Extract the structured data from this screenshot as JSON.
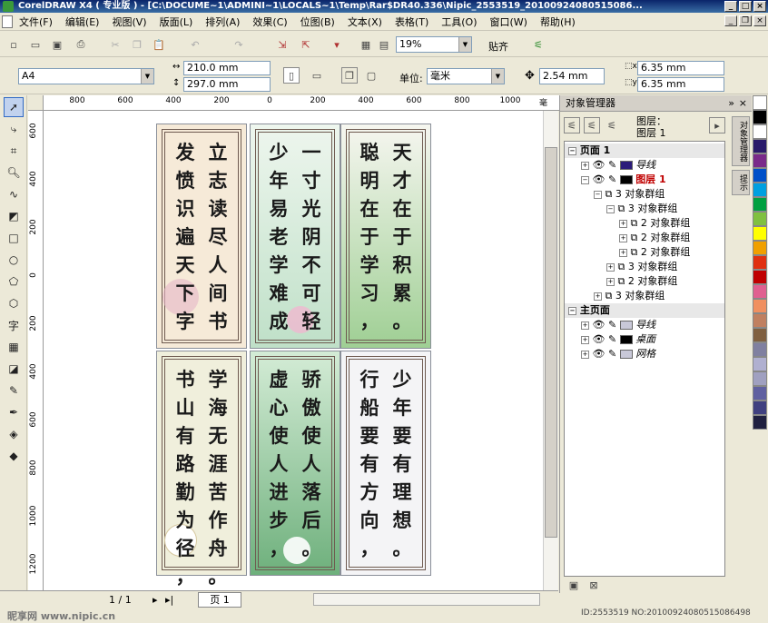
{
  "window": {
    "title": "CorelDRAW X4 ( 专业版 ) - [C:\\DOCUME~1\\ADMINI~1\\LOCALS~1\\Temp\\Rar$DR40.336\\Nipic_2553519_20100924080515086..."
  },
  "menu": [
    "文件(F)",
    "编辑(E)",
    "视图(V)",
    "版面(L)",
    "排列(A)",
    "效果(C)",
    "位图(B)",
    "文本(X)",
    "表格(T)",
    "工具(O)",
    "窗口(W)",
    "帮助(H)"
  ],
  "toolbar": {
    "zoom_value": "19%",
    "snap_label": "贴齐"
  },
  "propbar": {
    "paper_size": "A4",
    "width_value": "210.0 mm",
    "height_value": "297.0 mm",
    "unit_label": "单位:",
    "unit_value": "毫米",
    "nudge_value": "2.54 mm",
    "dup_x_value": "6.35 mm",
    "dup_y_value": "6.35 mm"
  },
  "ruler_h": [
    {
      "label": "800"
    },
    {
      "label": "600"
    },
    {
      "label": "400"
    },
    {
      "label": "200"
    },
    {
      "label": "0"
    },
    {
      "label": "200"
    },
    {
      "label": "400"
    },
    {
      "label": "600"
    },
    {
      "label": "800"
    },
    {
      "label": "1000"
    },
    {
      "label": "毫米"
    }
  ],
  "ruler_v": [
    {
      "label": "600"
    },
    {
      "label": "400"
    },
    {
      "label": "200"
    },
    {
      "label": "0"
    },
    {
      "label": "200"
    },
    {
      "label": "400"
    },
    {
      "label": "600"
    },
    {
      "label": "800"
    },
    {
      "label": "1000"
    },
    {
      "label": "1200"
    }
  ],
  "bookmarks": [
    {
      "columns": [
        "立志读尽人间书。",
        "发愤识遍天下字，"
      ],
      "colors": {
        "bg": "#f6ead8",
        "accent": "#e6b6c8"
      }
    },
    {
      "columns": [
        "一寸光阴不可轻。",
        "少年易老学难成，"
      ],
      "colors": {
        "bg": "#dff0e6",
        "accent": "#7cbf8c"
      }
    },
    {
      "columns": [
        "天才在于积累。",
        "聪明在于学习，"
      ],
      "colors": {
        "bg": "#eef3e6",
        "accent": "#90c48a"
      }
    },
    {
      "columns": [
        "学海无涯苦作舟。",
        "书山有路勤为径，"
      ],
      "colors": {
        "bg": "#f0efdc",
        "accent": "#c9d4a2"
      }
    },
    {
      "columns": [
        "骄傲使人落后。",
        "虚心使人进步，"
      ],
      "colors": {
        "bg": "#c6e2c8",
        "accent": "#4a9a5c"
      }
    },
    {
      "columns": [
        "少年要有理想。",
        "行船要有方向，"
      ],
      "colors": {
        "bg": "#f4f4f6",
        "accent": "#3a2a6e"
      }
    }
  ],
  "statusbar": {
    "page_counter": "1 / 1",
    "page_tab": "页 1"
  },
  "docker": {
    "title": "对象管理器",
    "layer_header": "图层：",
    "layer_value": "图层 1",
    "tree": [
      {
        "label": "页面 1",
        "indent": 0,
        "bold": true
      },
      {
        "label": "导线",
        "indent": 1,
        "color": "#2b1b7a"
      },
      {
        "label": "图层 1",
        "indent": 1,
        "color": "#000000",
        "red": true
      },
      {
        "label": "3 对象群组",
        "indent": 2
      },
      {
        "label": "3 对象群组",
        "indent": 3
      },
      {
        "label": "2 对象群组",
        "indent": 4
      },
      {
        "label": "2 对象群组",
        "indent": 4
      },
      {
        "label": "2 对象群组",
        "indent": 4
      },
      {
        "label": "3 对象群组",
        "indent": 3
      },
      {
        "label": "2 对象群组",
        "indent": 3
      },
      {
        "label": "3 对象群组",
        "indent": 2
      },
      {
        "label": "主页面",
        "indent": 0,
        "bold": true
      },
      {
        "label": "导线",
        "indent": 1,
        "color": "#c8c8d8"
      },
      {
        "label": "桌面",
        "indent": 1,
        "color": "#000000"
      },
      {
        "label": "网格",
        "indent": 1,
        "color": "#c8c8d8"
      }
    ]
  },
  "vtabs": [
    "对象管理器",
    "提示"
  ],
  "palette": [
    "#ffffff",
    "#000000",
    "#ffffff",
    "#2a1a6a",
    "#7a2a8a",
    "#0050c8",
    "#00a0e0",
    "#00a040",
    "#80c040",
    "#ffff00",
    "#f0a000",
    "#e03010",
    "#c00000",
    "#e06090",
    "#f09060",
    "#c08060",
    "#806040",
    "#8080a0",
    "#b0b0d0",
    "#a0a0c0",
    "#6060a0",
    "#404080",
    "#202040"
  ],
  "watermark": {
    "left": "昵享网 www.nipic.cn",
    "right": "ID:2553519 NO:20100924080515086498"
  }
}
